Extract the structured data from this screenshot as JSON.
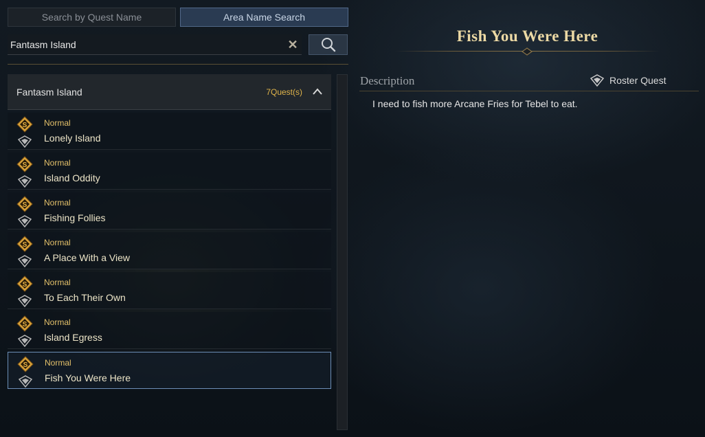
{
  "tabs": [
    {
      "label": "Search by Quest Name",
      "active": false
    },
    {
      "label": "Area Name Search",
      "active": true
    }
  ],
  "search": {
    "value": "Fantasm Island",
    "clear_icon": "close-icon",
    "search_icon": "search-icon"
  },
  "area_group": {
    "name": "Fantasm Island",
    "count_label": "7Quest(s)",
    "expanded": true
  },
  "quests": [
    {
      "type": "Normal",
      "name": "Lonely Island",
      "selected": false
    },
    {
      "type": "Normal",
      "name": "Island Oddity",
      "selected": false
    },
    {
      "type": "Normal",
      "name": "Fishing Follies",
      "selected": false
    },
    {
      "type": "Normal",
      "name": "A Place With a View",
      "selected": false
    },
    {
      "type": "Normal",
      "name": "To Each Their Own",
      "selected": false
    },
    {
      "type": "Normal",
      "name": "Island Egress",
      "selected": false
    },
    {
      "type": "Normal",
      "name": "Fish You Were Here",
      "selected": true
    }
  ],
  "detail": {
    "title": "Fish You Were Here",
    "description_label": "Description",
    "roster_tag": "Roster Quest",
    "description": "I need to fish more Arcane Fries for Tebel to eat."
  },
  "colors": {
    "accent_gold": "#e3c06a",
    "selected_border": "#6d8fb8",
    "active_tab": "#2a3b52"
  }
}
